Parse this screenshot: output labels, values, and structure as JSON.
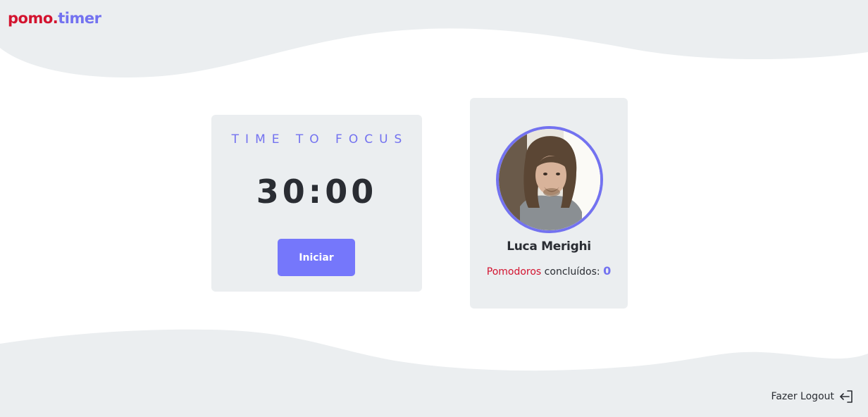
{
  "brand": {
    "part1": "pomo.",
    "part2": "timer",
    "color1": "#d3132f",
    "color2": "#7372f0"
  },
  "timer": {
    "heading": "TIME TO FOCUS",
    "time": "30:00",
    "start_label": "Iniciar"
  },
  "profile": {
    "name": "Luca Merighi",
    "avatar_icon": "user-photo",
    "stats_highlight": "Pomodoros",
    "stats_label": " concluídos: ",
    "completed_count": "0"
  },
  "logout": {
    "label": "Fazer Logout",
    "icon": "logout-icon"
  },
  "colors": {
    "accent": "#7372f0",
    "button": "#7577fb",
    "brand_red": "#d3132f",
    "card_bg": "#ebeef0",
    "text": "#2a2d33"
  }
}
